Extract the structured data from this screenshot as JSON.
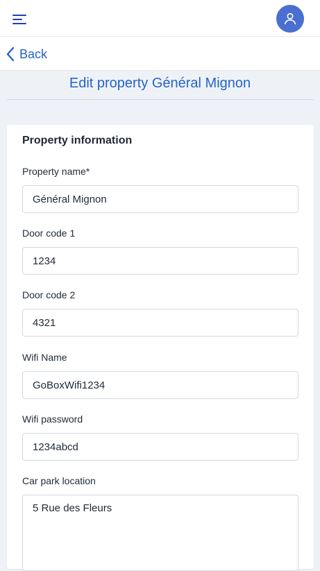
{
  "header": {
    "menu_icon": "hamburger-menu-icon",
    "avatar_icon": "user-icon",
    "brand_color": "#1e40af",
    "avatar_color": "#4a6fd0"
  },
  "nav": {
    "back_label": "Back",
    "back_icon": "chevron-left-icon"
  },
  "page": {
    "title": "Edit property Général Mignon"
  },
  "form": {
    "section_title": "Property information",
    "fields": [
      {
        "label": "Property name*",
        "value": "Général Mignon"
      },
      {
        "label": "Door code 1",
        "value": "1234"
      },
      {
        "label": "Door code 2",
        "value": "4321"
      },
      {
        "label": "Wifi Name",
        "value": "GoBoxWifi1234"
      },
      {
        "label": "Wifi password",
        "value": "1234abcd"
      },
      {
        "label": "Car park location",
        "value": "5 Rue des Fleurs"
      }
    ]
  }
}
